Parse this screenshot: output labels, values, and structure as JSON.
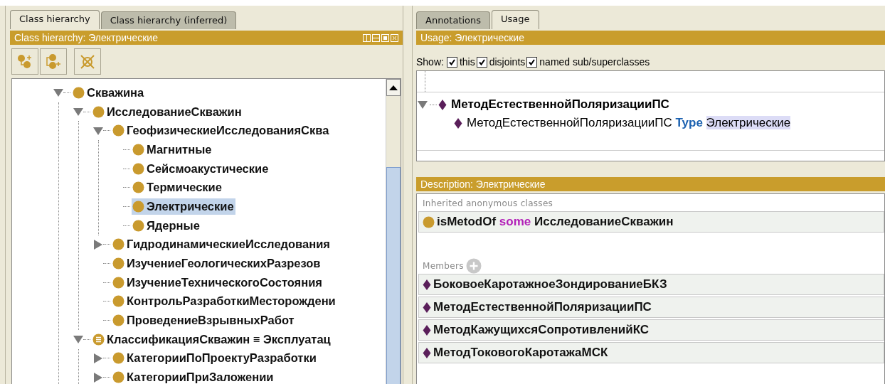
{
  "left": {
    "tabs": [
      {
        "label": "Class hierarchy",
        "selected": true
      },
      {
        "label": "Class hierarchy (inferred)",
        "selected": false
      }
    ],
    "header": {
      "title": "Class hierarchy:  Электрические"
    },
    "tree": [
      {
        "label": "Скважина",
        "kind": "class",
        "expanded": true,
        "selected": false,
        "children": [
          {
            "label": "ИсследованиеСкважин",
            "kind": "class",
            "expanded": true,
            "selected": false,
            "children": [
              {
                "label": "ГеофизическиеИсследованияСква",
                "kind": "class",
                "expanded": true,
                "selected": false,
                "children": [
                  {
                    "label": "Магнитные",
                    "kind": "class",
                    "selected": false
                  },
                  {
                    "label": "Сейсмоакустические",
                    "kind": "class",
                    "selected": false
                  },
                  {
                    "label": "Термические",
                    "kind": "class",
                    "selected": false
                  },
                  {
                    "label": "Электрические",
                    "kind": "class",
                    "selected": true
                  },
                  {
                    "label": "Ядерные",
                    "kind": "class",
                    "selected": false
                  }
                ]
              },
              {
                "label": "ГидродинамическиеИсследования",
                "kind": "class",
                "expanded": false,
                "selected": false
              },
              {
                "label": "ИзучениеГеологическихРазрезов",
                "kind": "class",
                "selected": false
              },
              {
                "label": "ИзучениеТехническогоСостояния",
                "kind": "class",
                "selected": false
              },
              {
                "label": "КонтрольРазработкиМесторождени",
                "kind": "class",
                "selected": false
              },
              {
                "label": "ПроведениеВзрывныхРабот",
                "kind": "class",
                "selected": false
              }
            ]
          },
          {
            "label": "КлассификацияСкважин ≡ Эксплуатац",
            "kind": "equivalent",
            "expanded": true,
            "selected": false,
            "children": [
              {
                "label": "КатегорииПоПроектуРазработки",
                "kind": "class",
                "expanded": false,
                "selected": false
              },
              {
                "label": "КатегорииПриЗаложении",
                "kind": "class",
                "expanded": false,
                "selected": false
              }
            ]
          }
        ]
      }
    ]
  },
  "right": {
    "tabs": [
      {
        "label": "Annotations",
        "selected": false
      },
      {
        "label": "Usage",
        "selected": true
      }
    ],
    "usage": {
      "title": "Usage:  Электрические",
      "show_label": "Show:",
      "filters": [
        {
          "label": "this",
          "checked": true
        },
        {
          "label": "disjoints",
          "checked": true
        },
        {
          "label": "named sub/superclasses",
          "checked": true
        }
      ],
      "items": [
        {
          "label": "МетодЕстественнойПоляризацииПС",
          "expanded": true,
          "children": [
            {
              "segments": [
                {
                  "text": "МетодЕстественнойПоляризацииПС ",
                  "kind": "plain"
                },
                {
                  "text": "Type ",
                  "kind": "keyword"
                },
                {
                  "text": "Электрические",
                  "kind": "match"
                }
              ]
            }
          ]
        }
      ]
    },
    "description": {
      "title": "Description:  Электрические",
      "sections": [
        {
          "heading": "Inherited anonymous classes",
          "rows": [
            {
              "kind": "class",
              "segments": [
                {
                  "text": "isMetodOf ",
                  "kind": "entity"
                },
                {
                  "text": "some",
                  "kind": "restriction"
                },
                {
                  "text": " ИсследованиеСкважин",
                  "kind": "entity"
                }
              ]
            }
          ]
        },
        {
          "heading": "Members",
          "add_button": true,
          "rows": [
            {
              "kind": "individual",
              "segments": [
                {
                  "text": "БоковоеКаротажноеЗондированиеБКЗ",
                  "kind": "entity"
                }
              ]
            },
            {
              "kind": "individual",
              "segments": [
                {
                  "text": "МетодЕстественнойПоляризацииПС",
                  "kind": "entity"
                }
              ]
            },
            {
              "kind": "individual",
              "segments": [
                {
                  "text": "МетодКажущихсяСопротивленийКС",
                  "kind": "entity"
                }
              ]
            },
            {
              "kind": "individual",
              "segments": [
                {
                  "text": "МетодТоковогоКаротажаМСК",
                  "kind": "entity"
                }
              ]
            }
          ]
        }
      ]
    }
  }
}
